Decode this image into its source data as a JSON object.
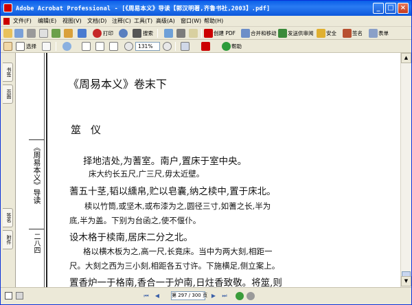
{
  "window": {
    "title": "Adobe Acrobat Professional - [《周易本义》导读【郭汉明著,齐鲁书社,2003】.pdf]",
    "min": "_",
    "max": "□",
    "close": "×"
  },
  "menu": [
    "文件(F)",
    "编辑(E)",
    "视图(V)",
    "文档(D)",
    "注释(C)",
    "工具(T)",
    "高级(A)",
    "窗口(W)",
    "帮助(H)"
  ],
  "toolbar1": {
    "create_pdf": "创建 PDF",
    "combine": "合并和移动",
    "send_review": "发送供审阅",
    "secure": "安全",
    "sign": "签名",
    "forms": "表单",
    "print": "打印",
    "search": "搜索"
  },
  "toolbar2": {
    "select": "选择",
    "zoom": "131%",
    "help": "帮助"
  },
  "nav_tabs": [
    "书签",
    "页面",
    "签名",
    "附件"
  ],
  "page": {
    "vertical_title": "《周易本义》导读",
    "vertical_page_no": "二八四",
    "lines": [
      "《周易本义》卷末下",
      "筮仪",
      "择地洁处,为蓍室。南户,置床于室中央。",
      "床大约长五尺,广三尺,毋太近壁。",
      "蓍五十茎,韬以纁帛,贮以皂囊,纳之椟中,置于床北。",
      "椟以竹筒,或坚木,或布漆为之,圆径三寸,如蓍之长,半为",
      "底,半为盖。下别为台函之,使不偃仆。",
      "设木格于椟南,居床二分之北。",
      "格以横木板为之,高一尺,长竟床。当中为两大刻,相距一",
      "尺。大刻之西为三小刻,相距各五寸许。下施横足,侧立案上。",
      "置香炉一于格南,香合一于炉南,日炷香致敬。将筮,则"
    ]
  },
  "status": {
    "page_display": "第 297 / 300 页"
  },
  "colors": {
    "titlebar": "#0a5fe8",
    "chrome": "#ece9d8",
    "close_button": "#c4391c"
  }
}
